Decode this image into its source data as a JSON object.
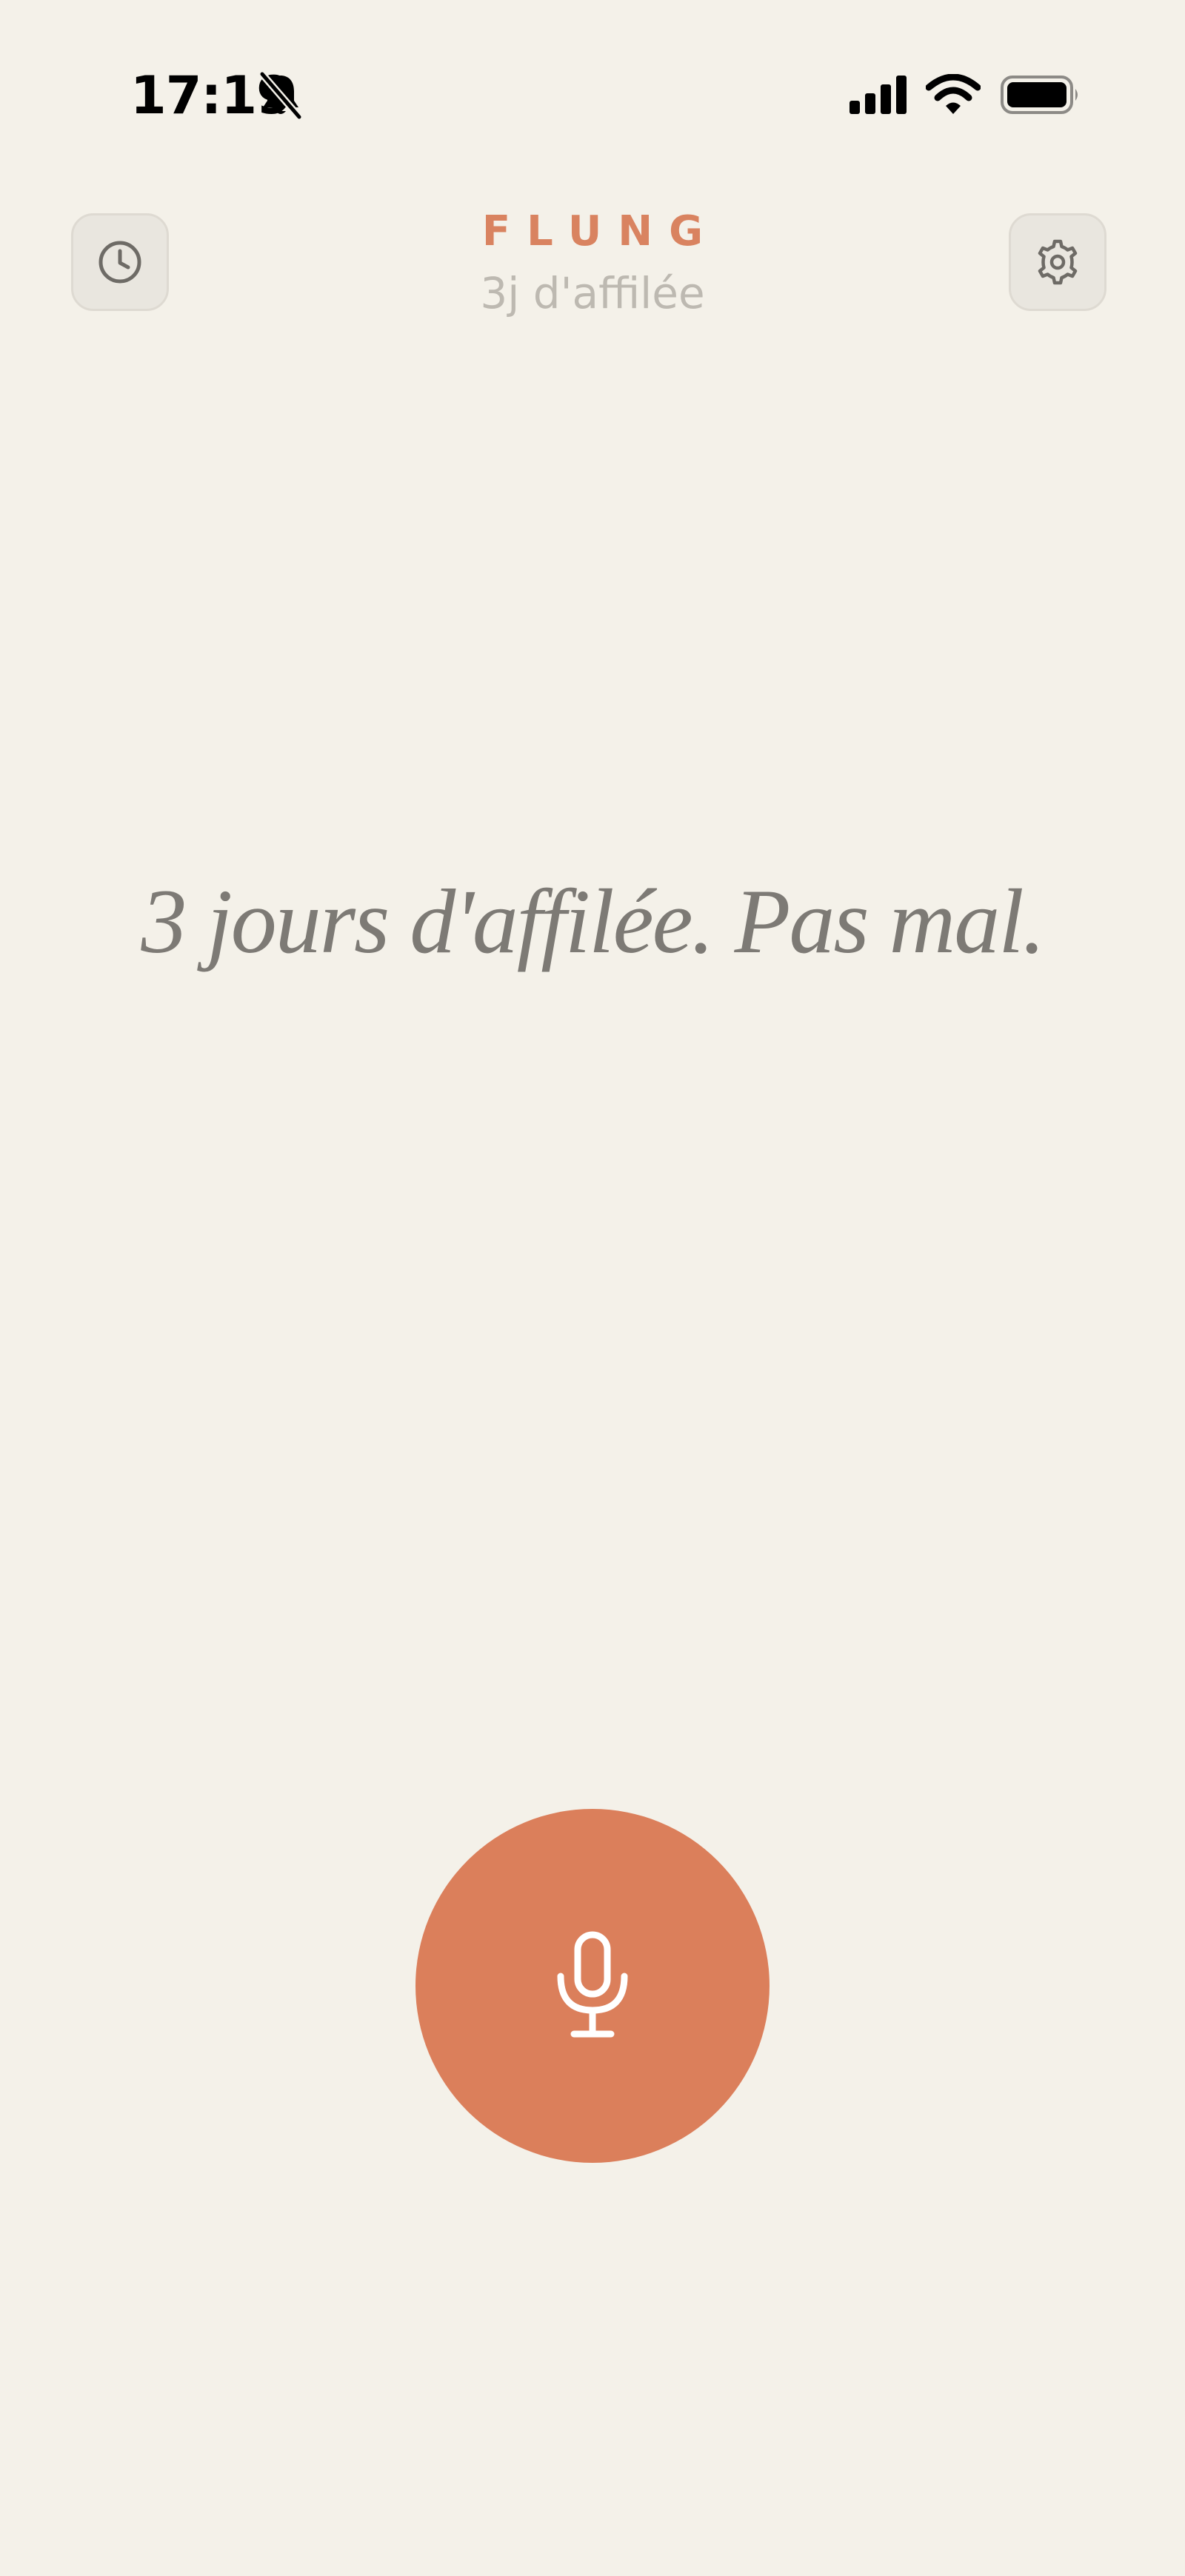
{
  "status_bar": {
    "time": "17:19",
    "icons": [
      "bell-slash-icon",
      "cellular-signal-icon",
      "wifi-icon",
      "battery-icon"
    ]
  },
  "header": {
    "title": "FLUNG",
    "streak": "3j d'affilée",
    "left_button_icon": "clock-history-icon",
    "right_button_icon": "gear-icon"
  },
  "main": {
    "message": "3 jours d'affilée. Pas mal."
  },
  "record": {
    "icon": "microphone-icon"
  },
  "colors": {
    "background": "#F4F1E9",
    "accent": "#DB7F5B",
    "title": "#D98360",
    "muted_text": "#BDB9B1",
    "message_text": "#7D7A75",
    "button_bg": "#E9E6DF"
  }
}
